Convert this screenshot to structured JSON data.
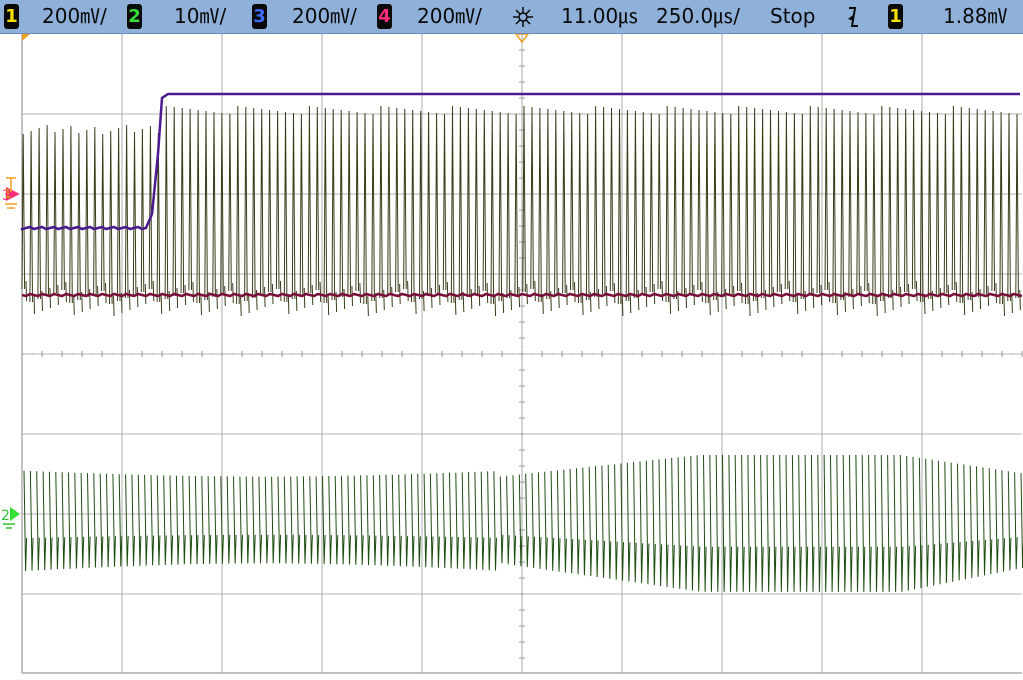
{
  "status_bar": {
    "channels": [
      {
        "number": "1",
        "scale": "200㎷/",
        "color": "#f5e000"
      },
      {
        "number": "2",
        "scale": "10㎷/",
        "color": "#33e033"
      },
      {
        "number": "3",
        "scale": "200㎷/",
        "color": "#3d6cff"
      },
      {
        "number": "4",
        "scale": "200㎷/",
        "color": "#ff2d7a"
      }
    ],
    "delay": "11.00㎲",
    "timebase": "250.0㎲/",
    "run_state": "Stop",
    "trigger_source": "1",
    "trigger_level": "1.88㎷"
  },
  "markers": {
    "ch3_label": "3",
    "ch1_label": "1",
    "ch2_label": "2"
  },
  "colors": {
    "ch1_trace": "#3b3b1a",
    "ch2_trace": "#1e4d12",
    "ch3_trace": "#4b1a8f",
    "ch4_trace": "#7a0f3c",
    "grid": "#9a9a9a",
    "trigger_marker": "#f0a020"
  },
  "icons": [
    "trigger-delay-icon",
    "falling-edge-trigger-icon"
  ]
}
